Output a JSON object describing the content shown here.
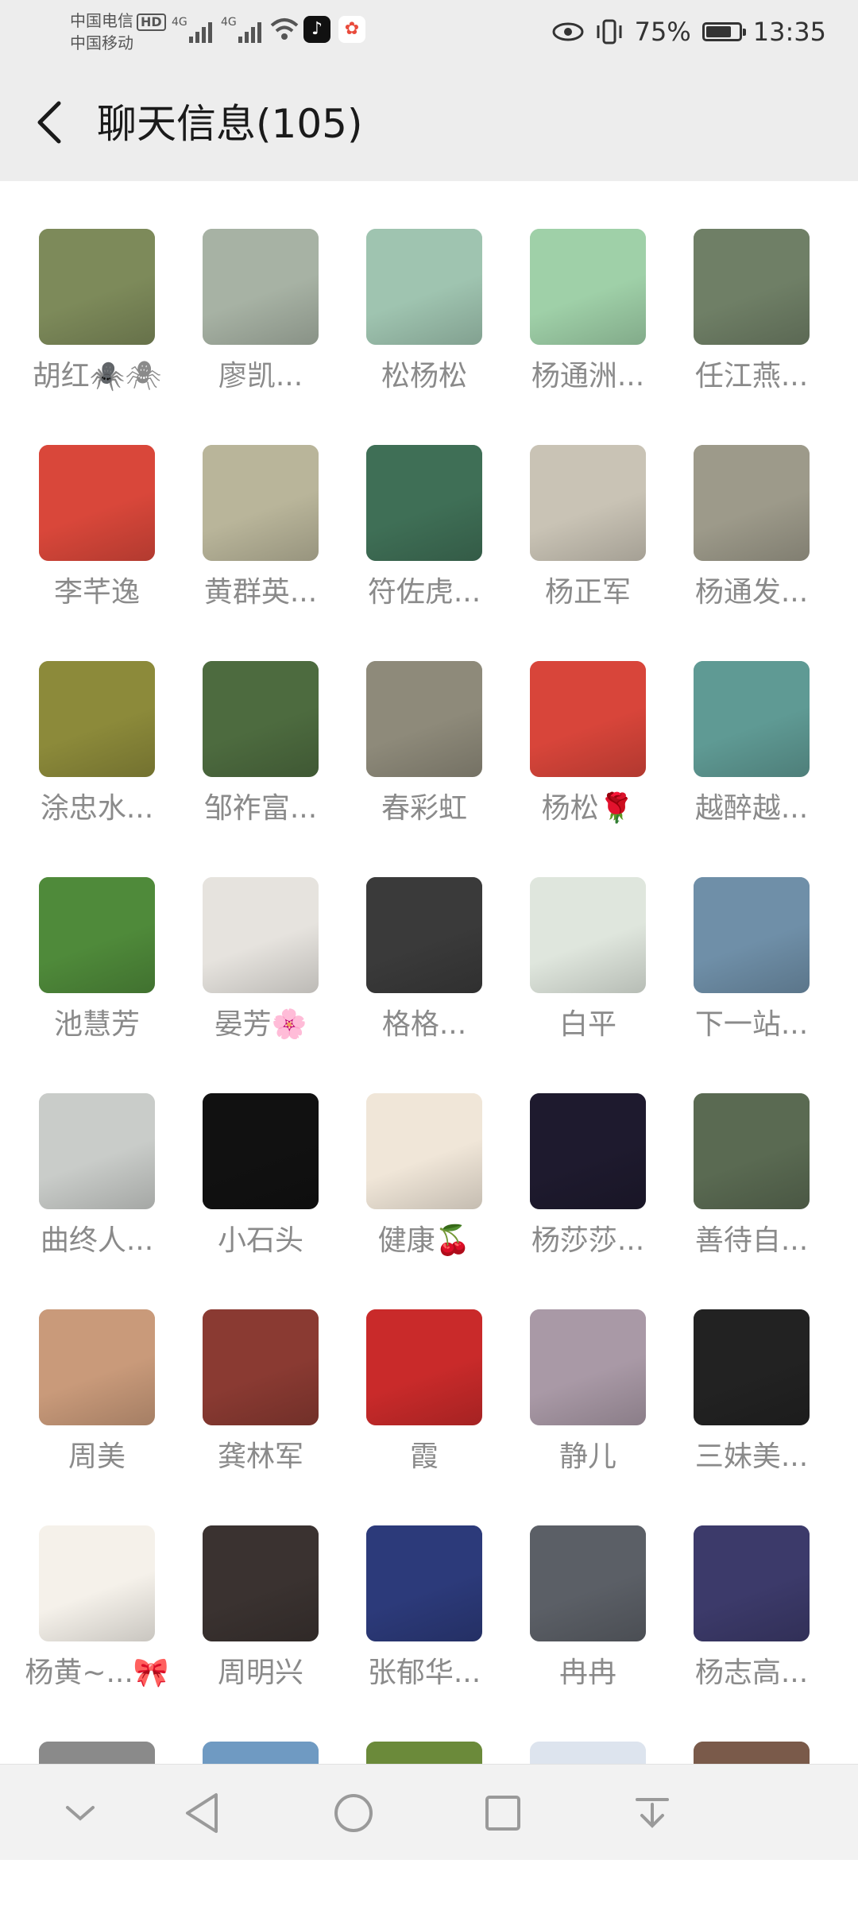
{
  "status_bar": {
    "carrier_1": "中国电信",
    "hd_badge": "HD",
    "carrier_2": "中国移动",
    "signal_1_label": "4G",
    "signal_2_label": "4G",
    "app_icon_1": "tiktok-icon",
    "app_icon_2": "ctrip-icon",
    "battery": "75%",
    "time": "13:35"
  },
  "header": {
    "back_icon": "back-chevron-icon",
    "title": "聊天信息(105)"
  },
  "members": [
    {
      "name": "胡红🕷️🕷",
      "color": "#7d8a5a"
    },
    {
      "name": "廖凯...",
      "color": "#a7b2a4"
    },
    {
      "name": "松杨松",
      "color": "#9fc4b0"
    },
    {
      "name": "杨通洲...",
      "color": "#9fd0a8"
    },
    {
      "name": "任江燕...",
      "color": "#6f7f66"
    },
    {
      "name": "李芊逸",
      "color": "#d9473a"
    },
    {
      "name": "黄群英...",
      "color": "#b9b59a"
    },
    {
      "name": "符佐虎...",
      "color": "#3f6f56"
    },
    {
      "name": "杨正军",
      "color": "#c9c3b5"
    },
    {
      "name": "杨通发...",
      "color": "#9d9a8a"
    },
    {
      "name": "涂忠水...",
      "color": "#8c8a3a"
    },
    {
      "name": "邹祚富...",
      "color": "#4d6b3f"
    },
    {
      "name": "春彩虹",
      "color": "#8e8a7a"
    },
    {
      "name": "杨松🌹",
      "color": "#d8453a"
    },
    {
      "name": "越醉越...",
      "color": "#5f9a94"
    },
    {
      "name": "池慧芳",
      "color": "#4f8a3a"
    },
    {
      "name": "晏芳🌸",
      "color": "#e6e3de"
    },
    {
      "name": "格格...",
      "color": "#3a3a3a"
    },
    {
      "name": "白平",
      "color": "#dfe6dd"
    },
    {
      "name": "下一站...",
      "color": "#6f8fa8"
    },
    {
      "name": "曲终人...",
      "color": "#c9ccc9"
    },
    {
      "name": "小石头",
      "color": "#111111"
    },
    {
      "name": "健康🍒",
      "color": "#f0e6d8"
    },
    {
      "name": "杨莎莎...",
      "color": "#1e1a2e"
    },
    {
      "name": "善待自...",
      "color": "#5a6a52"
    },
    {
      "name": "周美",
      "color": "#c99a7a"
    },
    {
      "name": "龚林军",
      "color": "#8a3a32"
    },
    {
      "name": "霞",
      "color": "#c92a2a"
    },
    {
      "name": "静儿",
      "color": "#a999a6"
    },
    {
      "name": "三妹美...",
      "color": "#222222"
    },
    {
      "name": "杨黄~...🎀",
      "color": "#f5f1ea"
    },
    {
      "name": "周明兴",
      "color": "#3a3230"
    },
    {
      "name": "张郁华...",
      "color": "#2c3a7a"
    },
    {
      "name": "冉冉",
      "color": "#5b5f66"
    },
    {
      "name": "杨志高...",
      "color": "#3c3a6a"
    },
    {
      "name": "",
      "color": "#8a8a8a"
    },
    {
      "name": "",
      "color": "#6f9ac2"
    },
    {
      "name": "",
      "color": "#6b8a3a"
    },
    {
      "name": "",
      "color": "#dde4ee"
    },
    {
      "name": "",
      "color": "#7a5a4a"
    }
  ],
  "navbar": {
    "icons": [
      "collapse-down-icon",
      "nav-back-icon",
      "nav-home-icon",
      "nav-recents-icon",
      "notification-pull-icon"
    ]
  }
}
